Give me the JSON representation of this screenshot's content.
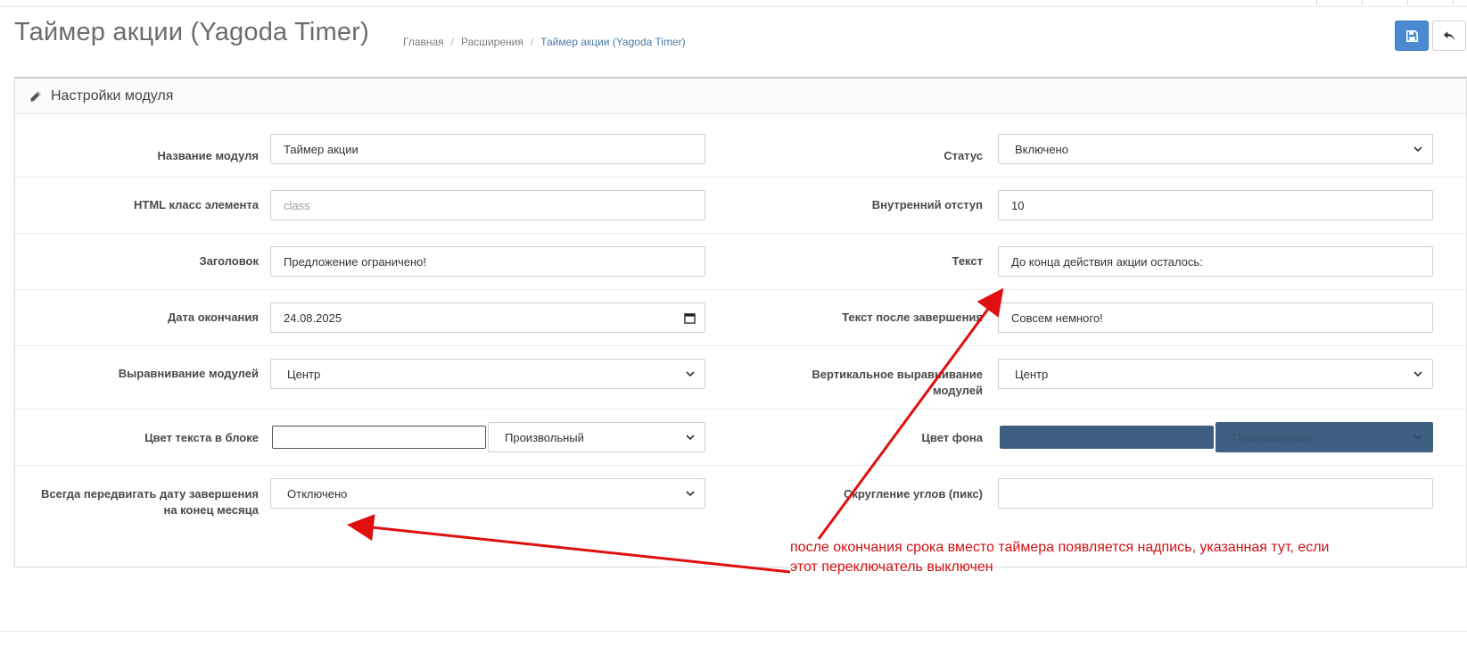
{
  "header": {
    "title": "Таймер акции (Yagoda Timer)",
    "breadcrumbs": [
      "Главная",
      "Расширения",
      "Таймер акции (Yagoda Timer)"
    ]
  },
  "toolbar": {
    "save_icon": "floppy-disk-icon",
    "back_icon": "reply-arrow-icon"
  },
  "panel": {
    "title": "Настройки модуля",
    "title_icon": "pencil-icon"
  },
  "form": {
    "module_name": {
      "label": "Название модуля",
      "value": "Таймер акции"
    },
    "status": {
      "label": "Статус",
      "value": "Включено"
    },
    "html_class": {
      "label": "HTML класс элемента",
      "value": "",
      "placeholder": "class"
    },
    "padding": {
      "label": "Внутренний отступ",
      "value": "10"
    },
    "heading": {
      "label": "Заголовок",
      "value": "Предложение ограничено!"
    },
    "text": {
      "label": "Текст",
      "value": "До конца действия акции осталось:"
    },
    "end_date": {
      "label": "Дата окончания",
      "value": "24.08.2025"
    },
    "text_after": {
      "label": "Текст после завершения",
      "value": "Совсем немного!"
    },
    "align": {
      "label": "Выравнивание модулей",
      "value": "Центр"
    },
    "valign": {
      "label_line1": "Вертикальное выравнивание",
      "label_line2": "модулей",
      "value": "Центр"
    },
    "text_color": {
      "label": "Цвет текста в блоке",
      "value": "",
      "mode": "Произвольный"
    },
    "bg_color": {
      "label": "Цвет фона",
      "value": "#3f5f82",
      "mode": "Произвольный"
    },
    "move_date": {
      "label_line1": "Всегда передвигать дату завершения",
      "label_line2": "на конец месяца",
      "value": "Отключено"
    },
    "border_radius": {
      "label": "Скругление углов (пикс)",
      "value": ""
    }
  },
  "annotation": {
    "line1": "после окончания срока вместо таймера появляется надпись, указанная тут, если",
    "line2": "этот переключатель выключен",
    "color": "#d01010"
  },
  "colors": {
    "accent": "#4b8ad2",
    "bg_swatch": "#3f5f82"
  }
}
